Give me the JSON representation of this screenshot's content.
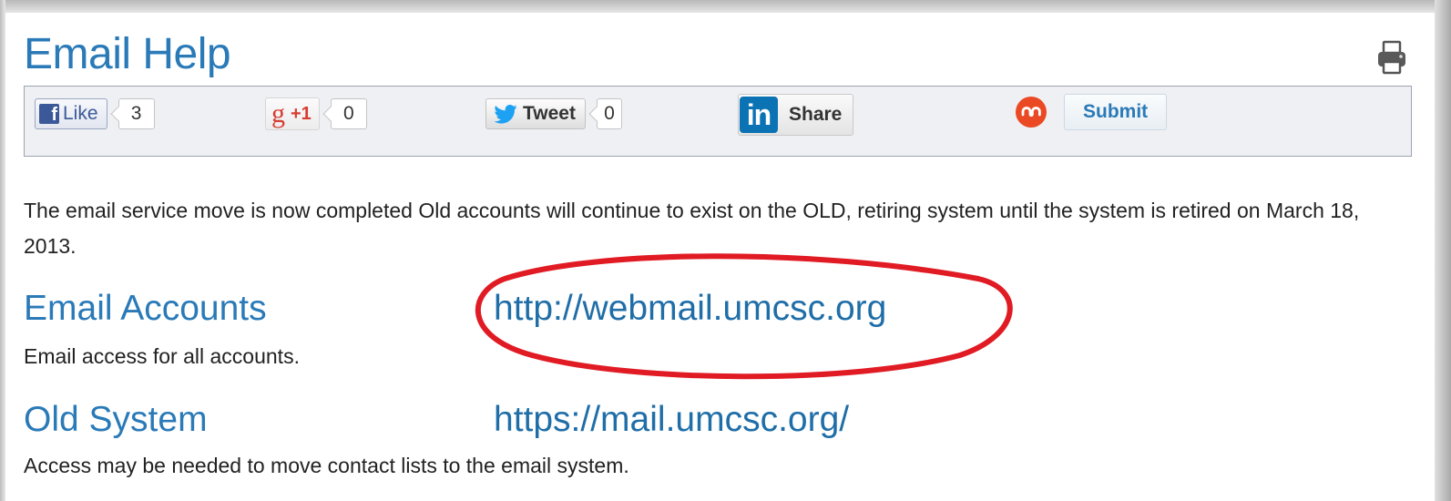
{
  "page": {
    "title": "Email Help",
    "print_icon": "printer-icon"
  },
  "share_bar": {
    "facebook": {
      "icon": "facebook-icon",
      "label": "Like",
      "count": "3",
      "color": "#3b5998"
    },
    "google_plus": {
      "icon": "google-plus-icon",
      "logo": "g",
      "label": "+1",
      "count": "0",
      "color": "#d73d32"
    },
    "twitter": {
      "icon": "twitter-bird-icon",
      "label": "Tweet",
      "count": "0",
      "color": "#1da1f2"
    },
    "linkedin": {
      "icon": "linkedin-icon",
      "logo": "in",
      "label": "Share",
      "color": "#0b73b3"
    },
    "stumbleupon": {
      "icon": "stumbleupon-icon",
      "label": "Submit",
      "color": "#eb4924"
    }
  },
  "intro_text": "The email service move is now completed  Old accounts will continue to exist on the OLD, retiring system until the system is retired on March 18, 2013.",
  "sections": [
    {
      "title": "Email Accounts",
      "link": "http://webmail.umcsc.org",
      "description": "Email access for all accounts.",
      "highlighted": true
    },
    {
      "title": "Old System",
      "link": "https://mail.umcsc.org/",
      "description": "Access may be needed to move contact lists to the email system.",
      "highlighted": false
    }
  ],
  "colors": {
    "heading_blue": "#2a7ab8",
    "annotation_red": "#e01b24"
  }
}
